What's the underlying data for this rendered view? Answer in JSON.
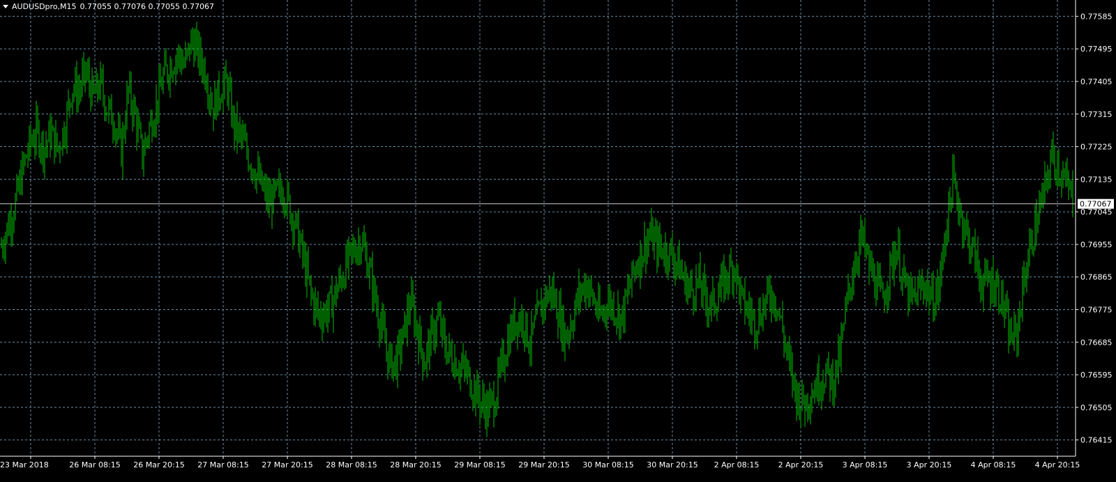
{
  "header": {
    "symbol": "AUDUSDpro,M15",
    "ohlc": "0.77055 0.77076 0.77055 0.77067"
  },
  "colors": {
    "background": "#000000",
    "bars": "#00c000",
    "grid": "#6b8fa6",
    "axis": "#ffffff",
    "price_line": "#c8c8c8"
  },
  "chart_data": {
    "type": "line",
    "title": "AUDUSDpro,M15",
    "xlabel": "",
    "ylabel": "",
    "grid": true,
    "ylim": [
      0.7637,
      0.7763
    ],
    "current_price_label": "0.77067",
    "current_price": 0.77067,
    "y_ticks": [
      "0.77585",
      "0.77495",
      "0.77405",
      "0.77315",
      "0.77225",
      "0.77135",
      "0.77045",
      "0.76955",
      "0.76865",
      "0.76775",
      "0.76685",
      "0.76595",
      "0.76505",
      "0.76415"
    ],
    "x_ticks": [
      "23 Mar 2018",
      "26 Mar 08:15",
      "26 Mar 20:15",
      "27 Mar 08:15",
      "27 Mar 20:15",
      "28 Mar 08:15",
      "28 Mar 20:15",
      "29 Mar 08:15",
      "29 Mar 20:15",
      "30 Mar 08:15",
      "30 Mar 20:15",
      "2 Apr 08:15",
      "2 Apr 20:15",
      "3 Apr 08:15",
      "3 Apr 20:15",
      "4 Apr 08:15",
      "4 Apr 20:15"
    ],
    "series": [
      {
        "values": [
          0.7695,
          0.7701,
          0.7707,
          0.7716,
          0.7723,
          0.7727,
          0.7722,
          0.7726,
          0.7722,
          0.7728,
          0.7739,
          0.7738,
          0.7743,
          0.7736,
          0.774,
          0.7733,
          0.773,
          0.7721,
          0.7738,
          0.7731,
          0.772,
          0.7728,
          0.7734,
          0.7742,
          0.7745,
          0.7748,
          0.7745,
          0.7752,
          0.7748,
          0.7743,
          0.7733,
          0.7738,
          0.774,
          0.7728,
          0.7725,
          0.772,
          0.7716,
          0.7711,
          0.7707,
          0.7709,
          0.7711,
          0.7705,
          0.7699,
          0.769,
          0.7681,
          0.7676,
          0.7677,
          0.768,
          0.7685,
          0.769,
          0.7694,
          0.7697,
          0.769,
          0.7681,
          0.7672,
          0.7663,
          0.7663,
          0.767,
          0.768,
          0.7672,
          0.7663,
          0.767,
          0.7675,
          0.7667,
          0.7664,
          0.7662,
          0.766,
          0.7656,
          0.7652,
          0.765,
          0.7653,
          0.7662,
          0.767,
          0.7675,
          0.7675,
          0.7668,
          0.7675,
          0.768,
          0.7683,
          0.7677,
          0.767,
          0.7675,
          0.7682,
          0.7685,
          0.768,
          0.7675,
          0.768,
          0.7678,
          0.7675,
          0.7683,
          0.769,
          0.7694,
          0.7698,
          0.7695,
          0.7694,
          0.7693,
          0.769,
          0.7685,
          0.7683,
          0.7685,
          0.768,
          0.7679,
          0.7683,
          0.7687,
          0.769,
          0.768,
          0.7677,
          0.7674,
          0.7678,
          0.7682,
          0.768,
          0.767,
          0.766,
          0.7653,
          0.7652,
          0.7655,
          0.7658,
          0.766,
          0.7658,
          0.7665,
          0.768,
          0.769,
          0.7698,
          0.769,
          0.7685,
          0.768,
          0.7688,
          0.7695,
          0.7685,
          0.768,
          0.7682,
          0.7685,
          0.768,
          0.7683,
          0.77,
          0.7713,
          0.7705,
          0.7698,
          0.7693,
          0.7685,
          0.7685,
          0.7685,
          0.768,
          0.767,
          0.767,
          0.7685,
          0.7695,
          0.7703,
          0.771,
          0.772,
          0.7717,
          0.7712,
          0.7709
        ]
      }
    ]
  }
}
